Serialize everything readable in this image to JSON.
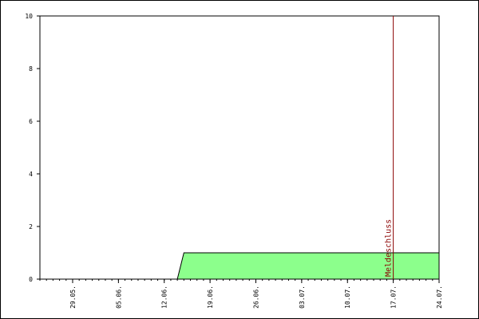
{
  "chart_data": {
    "type": "area",
    "title": "",
    "xlabel": "",
    "ylabel": "",
    "ylim": [
      0,
      10
    ],
    "y_ticks": [
      0,
      2,
      4,
      6,
      8,
      10
    ],
    "x_tick_labels": [
      "29.05.",
      "05.06.",
      "12.06.",
      "19.06.",
      "26.06.",
      "03.07.",
      "10.07.",
      "17.07.",
      "24.07."
    ],
    "series": [
      {
        "x": [
          "2024-05-24",
          "2024-06-14",
          "2024-06-15",
          "2024-07-24"
        ],
        "values": [
          0,
          0,
          1,
          1
        ]
      }
    ],
    "annotations": [
      {
        "type": "vertical-line",
        "x": "2024-07-17",
        "label": "Meldeschluss"
      }
    ],
    "grid": false,
    "legend": "none",
    "colors": {
      "fill": "#8cff8c",
      "line": "#000000",
      "annotation": "#8b0000",
      "tick_text": "#000000"
    }
  }
}
